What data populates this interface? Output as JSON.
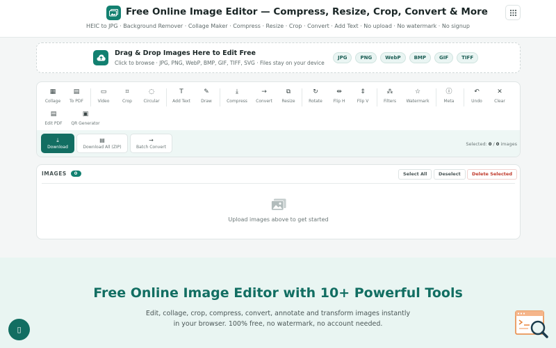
{
  "header": {
    "title": "Free Online Image Editor — Compress, Resize, Crop, Convert & More",
    "subtitle": "HEIC to JPG · Background Remover · Collage Maker · Compress · Resize · Crop · Convert · Add Text · No upload · No watermark · No signup"
  },
  "dropzone": {
    "title": "Drag & Drop Images Here to Edit Free",
    "subtitle": "Click to browse · JPG, PNG, WebP, BMP, GIF, TIFF, SVG · Files stay on your device",
    "formats": [
      "JPG",
      "PNG",
      "WebP",
      "BMP",
      "GIF",
      "TIFF"
    ]
  },
  "toolbar": {
    "tools": [
      "Collage",
      "To PDF",
      "Video",
      "Crop",
      "Circular",
      "Add Text",
      "Draw",
      "Compress",
      "Convert",
      "Resize",
      "Rotate",
      "Flip H",
      "Flip V",
      "Filters",
      "Watermark",
      "Meta",
      "Undo",
      "Clear",
      "Edit PDF",
      "QR Generator"
    ],
    "actions": [
      "Download",
      "Download All (ZIP)",
      "Batch Convert"
    ],
    "selected_label": "Selected:",
    "selected_count": "0",
    "selected_sep": "/",
    "total_count": "0",
    "selected_suffix": "images"
  },
  "images": {
    "heading": "IMAGES",
    "count": "0",
    "select_all": "Select All",
    "deselect": "Deselect",
    "delete_selected": "Delete Selected",
    "empty_text": "Upload images above to get started"
  },
  "hero": {
    "title": "Free Online Image Editor with 10+ Powerful Tools",
    "desc_line1": "Edit, collage, crop, compress, convert, annotate and transform images instantly",
    "desc_line2": "in your browser. 100% free, no watermark, no account needed."
  },
  "colors": {
    "accent": "#128070",
    "accent_dark": "#126e62",
    "danger": "#c0392b",
    "hero_bg": "#e9f5f2"
  },
  "icons": {
    "logo": "image-stack-icon",
    "menu": "grid-icon",
    "upload": "cloud-upload-icon",
    "empty": "image-placeholder-icon",
    "fab": "chat-icon",
    "corner": "search-document-icon"
  }
}
